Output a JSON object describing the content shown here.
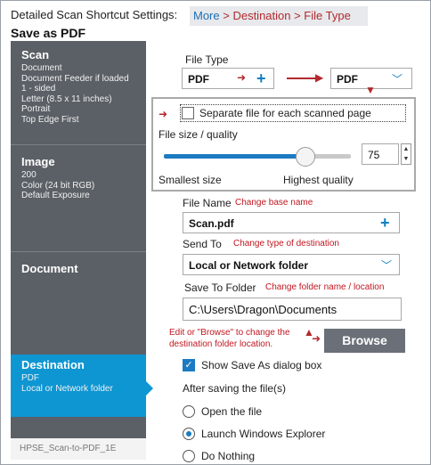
{
  "header": {
    "title": "Detailed Scan Shortcut Settings:",
    "subtitle": "Save as PDF",
    "breadcrumb_more": "More",
    "breadcrumb_rest": "> Destination > File Type"
  },
  "sidebar": {
    "sections": [
      {
        "title": "Scan",
        "details": [
          "Document",
          "Document Feeder if loaded",
          "1 - sided",
          "Letter (8.5 x 11 inches)",
          "Portrait",
          "Top Edge First"
        ]
      },
      {
        "title": "Image",
        "details": [
          "200",
          "Color (24 bit RGB)",
          "Default Exposure"
        ]
      },
      {
        "title": "Document",
        "details": []
      },
      {
        "title": "Destination",
        "details": [
          "PDF",
          "Local or Network folder"
        ]
      }
    ],
    "footer": "HPSE_Scan-to-PDF_1E"
  },
  "file_type": {
    "label": "File Type",
    "left_value": "PDF",
    "right_value": "PDF"
  },
  "pdf_options": {
    "separate_file_label": "Separate file for each scanned page",
    "separate_file_checked": false,
    "quality_label": "File size / quality",
    "slider_value": "75",
    "slider_fraction": 0.75,
    "min_label": "Smallest size",
    "max_label": "Highest quality"
  },
  "file_name": {
    "label": "File Name",
    "annotation": "Change base name",
    "value": "Scan.pdf"
  },
  "send_to": {
    "label": "Send To",
    "annotation": "Change type of destination",
    "value": "Local or Network folder"
  },
  "save_folder": {
    "label": "Save To Folder",
    "annotation": "Change folder name / location",
    "value": "C:\\Users\\Dragon\\Documents",
    "browse_note_line1": "Edit or \"Browse\" to change the",
    "browse_note_line2": "destination folder location.",
    "browse_label": "Browse"
  },
  "show_save_as": {
    "label": "Show Save As dialog box",
    "checked": true
  },
  "after_saving": {
    "label": "After saving the file(s)",
    "options": [
      "Open the file",
      "Launch Windows Explorer",
      "Do Nothing"
    ],
    "selected_index": 1
  },
  "colors": {
    "accent": "#0e96d3",
    "sidebar": "#5b6066",
    "annotation": "#c0171f"
  }
}
